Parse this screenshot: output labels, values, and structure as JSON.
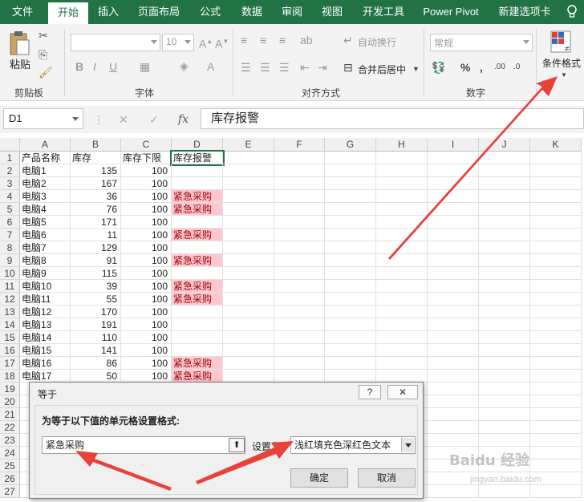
{
  "tabs": [
    {
      "label": "文件",
      "active": false
    },
    {
      "label": "开始",
      "active": true
    },
    {
      "label": "插入",
      "active": false
    },
    {
      "label": "页面布局",
      "active": false
    },
    {
      "label": "公式",
      "active": false
    },
    {
      "label": "数据",
      "active": false
    },
    {
      "label": "审阅",
      "active": false
    },
    {
      "label": "视图",
      "active": false
    },
    {
      "label": "开发工具",
      "active": false
    },
    {
      "label": "Power Pivot",
      "active": false
    },
    {
      "label": "新建选项卡",
      "active": false
    }
  ],
  "ribbon": {
    "clipboard": {
      "paste_label": "粘贴",
      "group_label": "剪贴板"
    },
    "font": {
      "size_value": "10",
      "group_label": "字体"
    },
    "alignment": {
      "wrap_label": "自动换行",
      "merge_label": "合并后居中",
      "group_label": "对齐方式"
    },
    "number": {
      "format_value": "常规",
      "group_label": "数字"
    },
    "styles": {
      "conditional_label": "条件格式"
    }
  },
  "formula_bar": {
    "name_box": "D1",
    "content": "库存报警"
  },
  "columns": [
    "A",
    "B",
    "C",
    "D",
    "E",
    "F",
    "G",
    "H",
    "I",
    "J",
    "K"
  ],
  "sheet": {
    "header_row": [
      "产品名称",
      "库存",
      "库存下限",
      "库存报警"
    ],
    "rows": [
      {
        "name": "电脑1",
        "stock": "135",
        "min": "100",
        "alarm": ""
      },
      {
        "name": "电脑2",
        "stock": "167",
        "min": "100",
        "alarm": ""
      },
      {
        "name": "电脑3",
        "stock": "36",
        "min": "100",
        "alarm": "紧急采购"
      },
      {
        "name": "电脑4",
        "stock": "76",
        "min": "100",
        "alarm": "紧急采购"
      },
      {
        "name": "电脑5",
        "stock": "171",
        "min": "100",
        "alarm": ""
      },
      {
        "name": "电脑6",
        "stock": "11",
        "min": "100",
        "alarm": "紧急采购"
      },
      {
        "name": "电脑7",
        "stock": "129",
        "min": "100",
        "alarm": ""
      },
      {
        "name": "电脑8",
        "stock": "91",
        "min": "100",
        "alarm": "紧急采购"
      },
      {
        "name": "电脑9",
        "stock": "115",
        "min": "100",
        "alarm": ""
      },
      {
        "name": "电脑10",
        "stock": "39",
        "min": "100",
        "alarm": "紧急采购"
      },
      {
        "name": "电脑11",
        "stock": "55",
        "min": "100",
        "alarm": "紧急采购"
      },
      {
        "name": "电脑12",
        "stock": "170",
        "min": "100",
        "alarm": ""
      },
      {
        "name": "电脑13",
        "stock": "191",
        "min": "100",
        "alarm": ""
      },
      {
        "name": "电脑14",
        "stock": "110",
        "min": "100",
        "alarm": ""
      },
      {
        "name": "电脑15",
        "stock": "141",
        "min": "100",
        "alarm": ""
      },
      {
        "name": "电脑16",
        "stock": "86",
        "min": "100",
        "alarm": "紧急采购"
      },
      {
        "name": "电脑17",
        "stock": "50",
        "min": "100",
        "alarm": "紧急采购"
      }
    ],
    "alarm_fill": "#ffc7ce",
    "alarm_text": "#9c0006"
  },
  "dialog": {
    "title": "等于",
    "help": "?",
    "close": "✕",
    "prompt": "为等于以下值的单元格设置格式:",
    "value": "紧急采购",
    "set_label": "设置为",
    "format_option": "浅红填充色深红色文本",
    "ok_label": "确定",
    "cancel_label": "取消"
  },
  "watermark": {
    "text": "Baidu 经验",
    "sub": "jingyan.baidu.com"
  },
  "accent": "#217346",
  "arrow_color": "#e8413a"
}
